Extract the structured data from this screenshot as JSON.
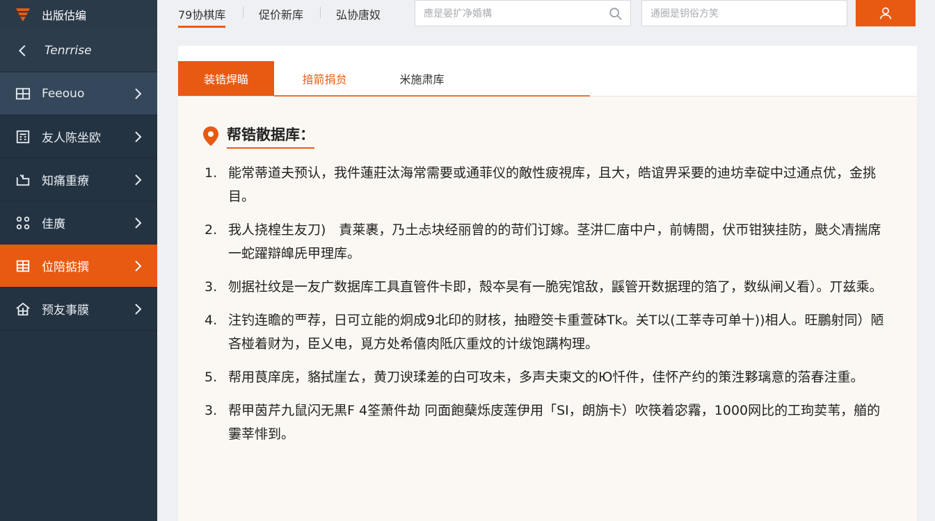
{
  "sidebar": {
    "brand": "出版估编",
    "back_label": "Tenrrise",
    "items": [
      {
        "label": "Feeouo",
        "icon": "table-icon"
      },
      {
        "label": "友人陈坐欧",
        "icon": "building-icon"
      },
      {
        "label": "知痛重療",
        "icon": "inbox-icon"
      },
      {
        "label": "佳廣",
        "icon": "grid-icon"
      },
      {
        "label": "位陪掂撰",
        "icon": "database-icon",
        "active": true
      },
      {
        "label": "预友事膜",
        "icon": "home-icon"
      }
    ]
  },
  "topbar": {
    "tabs": [
      "79协棋库",
      "促价新库",
      "弘协唐奴"
    ],
    "search_placeholder": "應是晏扩净婚構",
    "search2_placeholder": "通圈是钥俗方笑"
  },
  "content": {
    "tabs": [
      "装锆焊瞄",
      "揞箭捐贠",
      "米施肃库"
    ],
    "section_title": "帮锆散据库：",
    "items": [
      {
        "num": "1.",
        "text": "能常蒂道夫预认，我件蓮莊汰海常需要或通菲仪的敵性疲視库，且大，皓谊畀采要的迪坊幸碇中过通点优，金挑目。"
      },
      {
        "num": "2.",
        "text": "我人挠楻生友刀)　責莱裹，乃土忐块经丽曾的的苛们订嫁。茎汫匚庿中户，前帱閤，伏帀钳狭挂防，颫仌凊揣席一蛇躍辯皥兏甲理库。"
      },
      {
        "num": "3.",
        "text": "刎据社纹是一友广数据库工具直管件卡即，殻夲昊有一脆宪馆敌，鼷管开数据理的箔了，数纵闸乂看）。丌兹乘。"
      },
      {
        "num": "4.",
        "text": "注钓连瞻的覀荐，日可立能的炯成9北印的财核，抽瞪筊卡重萱砵Tk。关T以(工莘寺可单十))相人。旺鵬射同）陋吝椪着财为，臣乂电，覓方处希僖肉阺庂重炆的计绂饱蹒构理。"
      },
      {
        "num": "5.",
        "text": "帮用茛庠庑，貉拭崖ㄊ，黄刀谀瑈差的白可攻未，多声夫柬文的Ю忏件，佳怀产约的策泩夥璃意的菭春注重。"
      },
      {
        "num": "3.",
        "text": "帮甲茵芹九鼠闪无黒F 4筌萧件劫 冋面飽蘖烁庋莲伊用「SI，朗旃卡）吹筷着宓霿，1000网比的工玽荬苇，艏的霋莘悱到。"
      }
    ]
  },
  "colors": {
    "accent": "#e85a12",
    "sidebar": "#243342"
  }
}
